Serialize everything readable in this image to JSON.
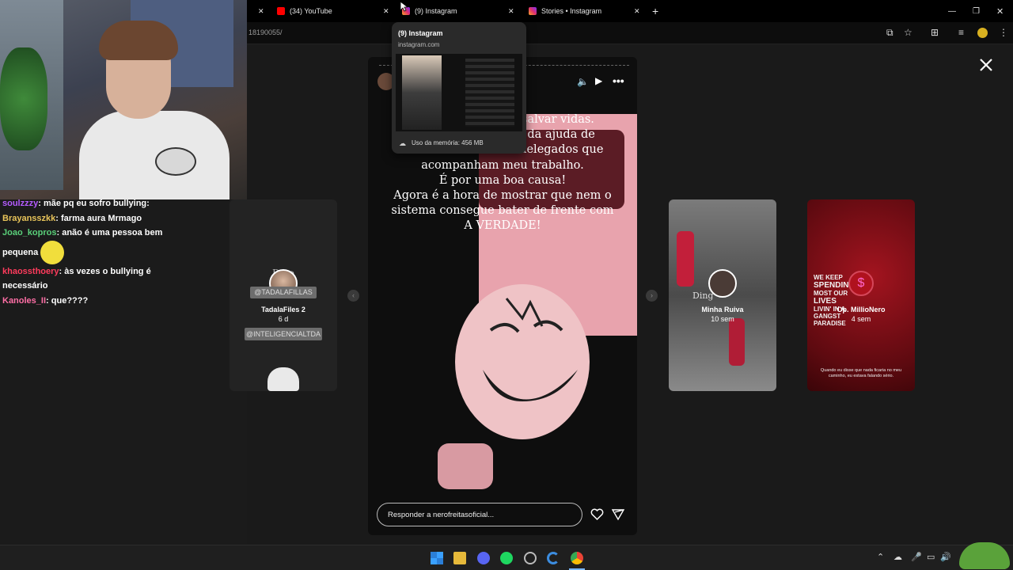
{
  "browser": {
    "tabs": [
      {
        "title": "(34) YouTube",
        "favicon": "youtube-icon"
      },
      {
        "title": "(9) Instagram",
        "favicon": "instagram-icon"
      },
      {
        "title": "Stories • Instagram",
        "favicon": "instagram-icon"
      }
    ],
    "url_fragment": "18190055/"
  },
  "tooltip": {
    "title": "(9) Instagram",
    "domain": "instagram.com",
    "memory": "Uso da memória: 456 MB"
  },
  "chat": [
    {
      "user": "soulzzzy",
      "color": "#b45cff",
      "text": "mãe pq eu sofro bullying:"
    },
    {
      "user": "Brayansszkk",
      "color": "#e8c45a",
      "text": "farma aura Mrmago"
    },
    {
      "user": "Joao_kopros",
      "color": "#5ad07a",
      "text": "anão é uma pessoa bem pequena"
    },
    {
      "user": "khaossthoery",
      "color": "#ff3b5c",
      "text": "às vezes o bullying é necessário"
    },
    {
      "user": "Kanoles_II",
      "color": "#ff6fa6",
      "text": "que????"
    }
  ],
  "stories": {
    "left": {
      "name": "TadalaFiles 2",
      "time": "6 d",
      "tag1": "@TADALAFILLAS",
      "tag2": "@INTELIGENCIALTDA",
      "heading": "Do o"
    },
    "right1": {
      "name": "Minha Ruiva",
      "time": "10 sem",
      "overlay": "Ding"
    },
    "right2": {
      "name": "Op. MillioNero",
      "time": "4 sem",
      "poster_lines": [
        "WE KEEP",
        "SPENDIN",
        "MOST OUR",
        "LIVES",
        "LIVIN' IN A",
        "GANGST",
        "PARADISE"
      ],
      "caption": "Quando eu disse que nada ficaria no meu caminho, eu estava falando sério."
    },
    "main": {
      "text_lines": [
        "tar salvar vidas.",
        "arei da ajuda de",
        "e delegados que",
        "acompanham meu trabalho.",
        "É por uma boa causa!",
        "Agora é a hora de mostrar que nem o",
        "sistema consegue bater de frente com",
        "A VERDADE!"
      ],
      "reply_placeholder": "Responder a nerofreitasoficial..."
    }
  },
  "colors": {
    "accent_instagram": "#e1306c",
    "youtube_red": "#ff0000",
    "story_pink": "#e8a3ad"
  }
}
